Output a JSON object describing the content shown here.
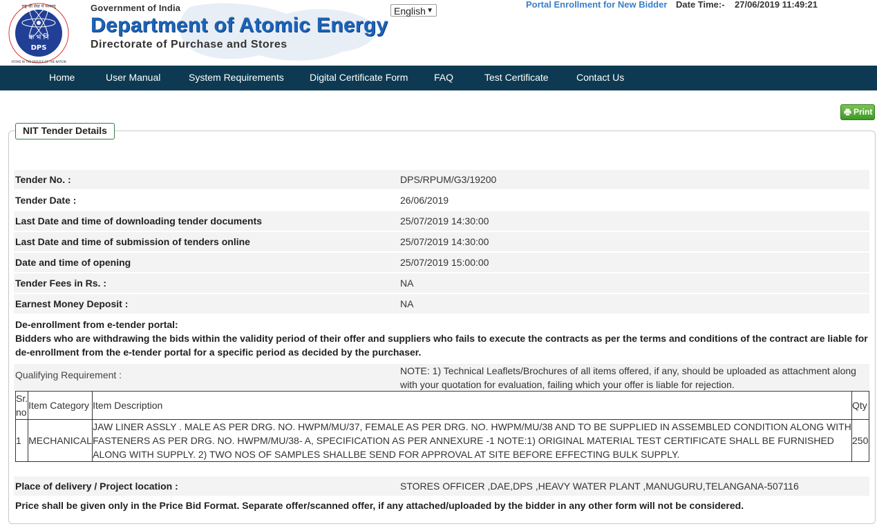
{
  "header": {
    "logo_hindi": "राष्ट्र की सेवा में परमाणु",
    "logo_center": "क भं नि",
    "logo_abbr": "DPS",
    "logo_ring": "ATOMS IN THE SERVICE OF THE NATION",
    "gov": "Government of India",
    "dept": "Department of Atomic Energy",
    "directorate": "Directorate of Purchase and Stores",
    "language": "English",
    "portal_link": "Portal Enrollment for New Bidder",
    "datetime_label": "Date Time:-",
    "datetime_value": "27/06/2019 11:49:21"
  },
  "nav": {
    "items": [
      "Home",
      "User Manual",
      "System Requirements",
      "Digital Certificate Form",
      "FAQ",
      "Test Certificate",
      "Contact Us"
    ]
  },
  "print_label": "Print",
  "panel": {
    "title": "NIT Tender Details",
    "rows": [
      {
        "label": "Tender No. :",
        "value": "DPS/RPUM/G3/19200"
      },
      {
        "label": "Tender Date :",
        "value": "26/06/2019"
      },
      {
        "label": "Last Date and time of downloading tender documents",
        "value": "25/07/2019 14:30:00"
      },
      {
        "label": "Last Date and time of submission of tenders online",
        "value": "25/07/2019 14:30:00"
      },
      {
        "label": "Date and time of opening",
        "value": "25/07/2019 15:00:00"
      },
      {
        "label": "Tender Fees in Rs. :",
        "value": "NA"
      },
      {
        "label": "Earnest Money Deposit :",
        "value": "NA"
      }
    ],
    "deenrollment_title": "De-enrollment from e-tender portal:",
    "deenrollment_text": "Bidders who are withdrawing the bids within the validity period of their offer and suppliers who fails to execute the contracts as per the terms and conditions of the contract are liable for de-enrollment from the e-tender portal for a specific period as decided by the purchaser.",
    "qualifying_label": "Qualifying Requirement :",
    "qualifying_value": "NOTE: 1) Technical Leaflets/Brochures of all items offered, if any, should be uploaded as attachment along with your quotation for evaluation, failing which your offer is liable for rejection.",
    "table": {
      "headers": {
        "sr": "Sr. no",
        "category": "Item Category",
        "description": "Item Description",
        "qty": "Qty"
      },
      "rows": [
        {
          "sr": "1",
          "category": "MECHANICAL",
          "description": "JAW LINER ASSLY . MALE AS PER DRG. NO. HWPM/MU/37, FEMALE AS PER DRG. NO. HWPM/MU/38 AND TO BE SUPPLIED IN ASSEMBLED CONDITION ALONG WITH FASTENERS AS PER DRG. NO. HWPM/MU/38- A, SPECIFICATION AS PER ANNEXURE -1 NOTE:1) ORIGINAL MATERIAL TEST CERTIFICATE SHALL BE FURNISHED ALONG WITH SUPPLY. 2) TWO NOS OF SAMPLES SHALLBE SEND FOR APPROVAL AT SITE BEFORE EFFECTING BULK SUPPLY.",
          "qty": "250"
        }
      ]
    },
    "delivery_label": "Place of delivery / Project location :",
    "delivery_value": "STORES OFFICER ,DAE,DPS ,HEAVY WATER PLANT ,MANUGURU,TELANGANA-507116",
    "price_note": "Price shall be given only in the Price Bid Format. Separate offer/scanned offer, if any attached/uploaded by the bidder in any other form will not be considered."
  },
  "colors": {
    "nav_bg": "#0d3a52",
    "dept_blue": "#1d63b7",
    "link_blue": "#3a7ec8",
    "print_green": "#4caf2f",
    "legend_border": "#3a7a44"
  }
}
